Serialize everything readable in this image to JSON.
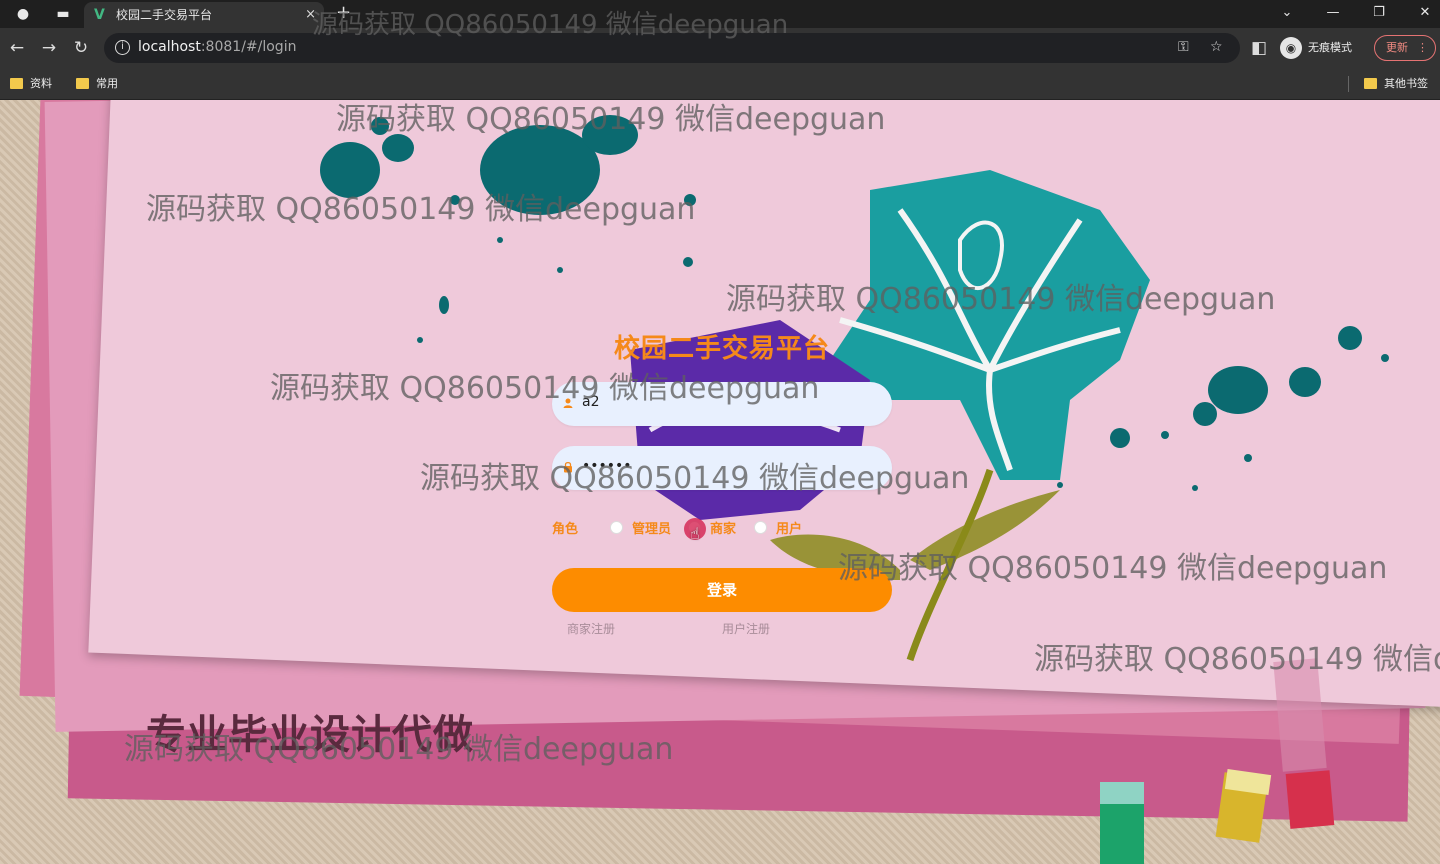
{
  "browser": {
    "tab_title": "校园二手交易平台",
    "tab_close": "×",
    "new_tab": "+",
    "url_host": "localhost",
    "url_path": ":8081/#/login",
    "incognito_label": "无痕模式",
    "update_label": "更新",
    "bookmarks": [
      "资料",
      "常用"
    ],
    "other_bookmarks": "其他书签"
  },
  "page": {
    "title": "校园二手交易平台",
    "username_value": "a2",
    "password_value": "••••••",
    "role_label": "角色",
    "roles": [
      "管理员",
      "商家",
      "用户"
    ],
    "login_button": "登录",
    "merchant_register": "商家注册",
    "user_register": "用户注册",
    "slogan": "专业毕业设计代做"
  },
  "watermark": "源码获取 QQ86050149 微信deepguan",
  "watermark_cut": "源码获取 QQ86050149 微信d",
  "colors": {
    "accent": "#fd8c00",
    "title": "#f5891a",
    "teal": "#1a9ea0",
    "ink": "#0b6a70",
    "purple": "#5b2aa8"
  }
}
